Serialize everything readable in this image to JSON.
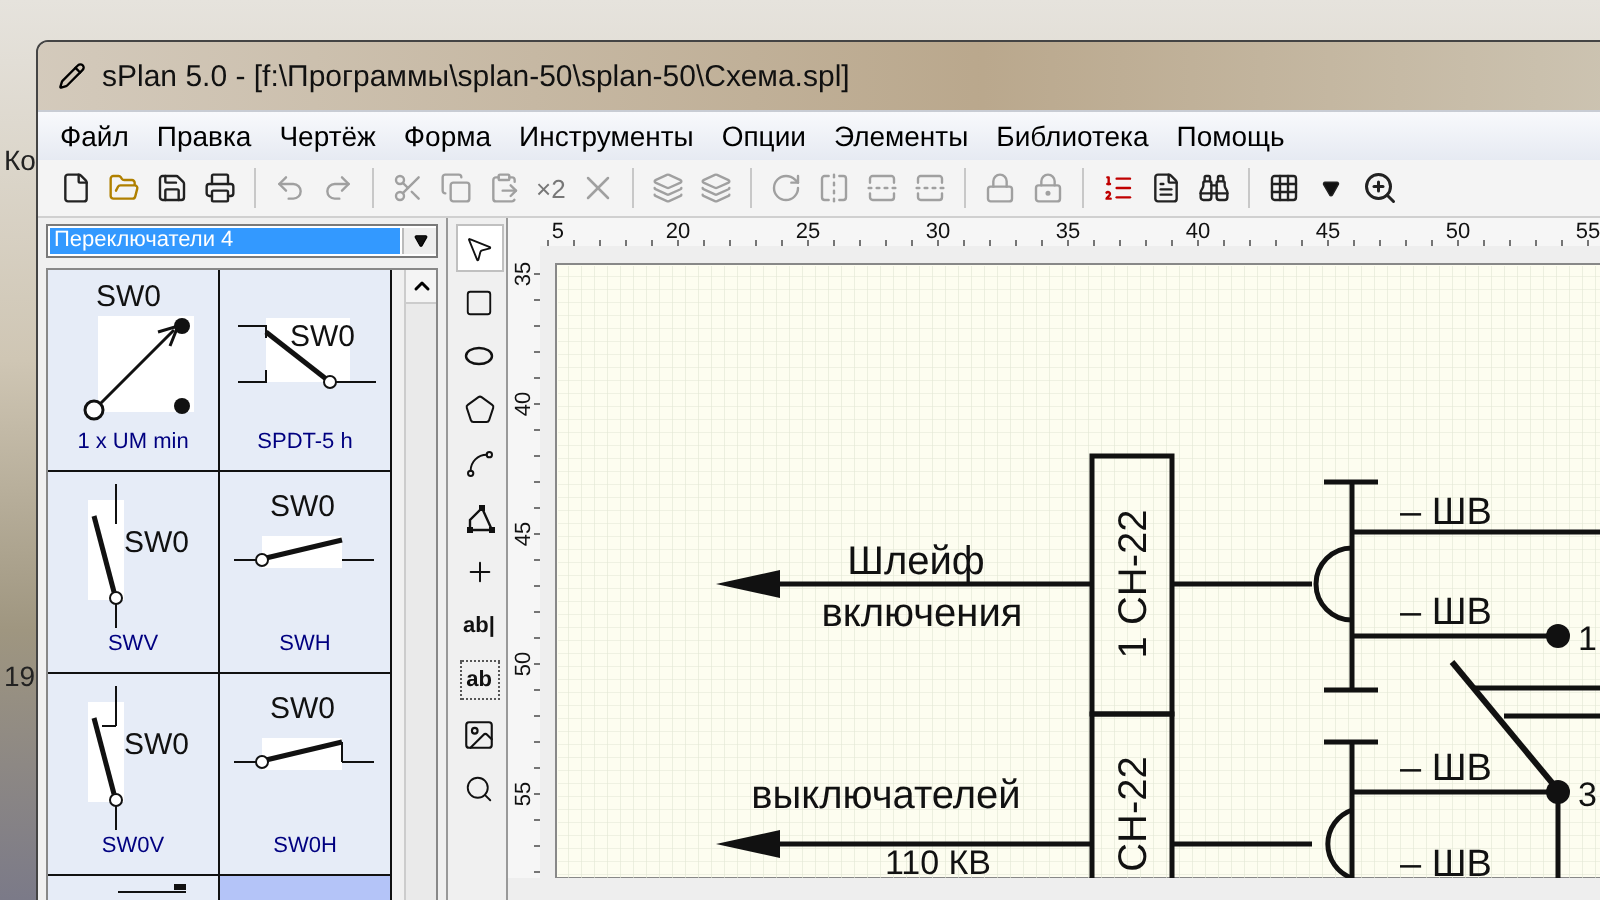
{
  "desktop": {
    "labels": [
      {
        "text": "Ко"
      },
      {
        "text": "19"
      }
    ]
  },
  "window": {
    "title": "sPlan 5.0 - [f:\\Программы\\splan-50\\splan-50\\Схема.spl]"
  },
  "menu": [
    "Файл",
    "Правка",
    "Чертёж",
    "Форма",
    "Инструменты",
    "Опции",
    "Элементы",
    "Библиотека",
    "Помощь"
  ],
  "toolbar": {
    "duplicate_label": "×2"
  },
  "library": {
    "selector": "Переключатели 4",
    "items": [
      {
        "kind": "arrow-toggle",
        "symbol": "SW0",
        "label": "1 x UM min",
        "selected": false
      },
      {
        "kind": "spdt",
        "symbol": "SW0",
        "label": "SPDT-5 h",
        "selected": false
      },
      {
        "kind": "vertical",
        "symbol": "SW0",
        "label": "SWV",
        "selected": false
      },
      {
        "kind": "horizontal",
        "symbol": "SW0",
        "label": "SWH",
        "selected": false
      },
      {
        "kind": "vertical-open",
        "symbol": "SW0",
        "label": "SW0V",
        "selected": false
      },
      {
        "kind": "horizontal-open",
        "symbol": "SW0",
        "label": "SW0H",
        "selected": false
      },
      {
        "kind": "cut",
        "selected": false
      },
      {
        "kind": "blank",
        "selected": true
      }
    ]
  },
  "tools": [
    {
      "kind": "pointer",
      "selected": true
    },
    {
      "kind": "rectangle",
      "selected": false
    },
    {
      "kind": "ellipse",
      "selected": false
    },
    {
      "kind": "polygon",
      "selected": false
    },
    {
      "kind": "bezier",
      "selected": false
    },
    {
      "kind": "polyline",
      "selected": false
    },
    {
      "kind": "junction",
      "selected": false
    },
    {
      "kind": "text",
      "label": "ab|",
      "selected": false
    },
    {
      "kind": "textbox",
      "label": "ab",
      "selected": false
    },
    {
      "kind": "image",
      "selected": false
    },
    {
      "kind": "zoom",
      "selected": false
    }
  ],
  "canvas": {
    "x_ticks": [
      "5",
      "20",
      "25",
      "30",
      "35",
      "40",
      "45",
      "50",
      "55"
    ],
    "y_ticks": [
      "35",
      "40",
      "45",
      "50",
      "55"
    ],
    "labels": {
      "loop_1": "Шлейф",
      "loop_2": "включения",
      "switches": "выключателей",
      "voltage": "110 КВ"
    },
    "blocks": [
      "1 СН-22",
      "СН-22"
    ],
    "contacts": [
      "– ШВ",
      "– ШВ",
      "– ШВ",
      "– ШВ"
    ],
    "pins": [
      "1",
      "3"
    ]
  }
}
